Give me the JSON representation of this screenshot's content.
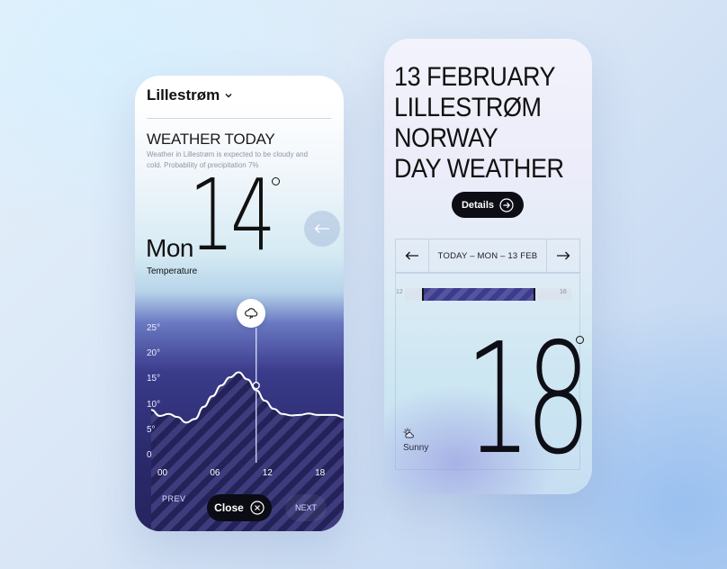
{
  "left_phone": {
    "city": "Lillestrøm",
    "title": "WEATHER TODAY",
    "description": "Weather in Lillestrøm is expected to be cloudy and cold. Probability of precipitation 7%",
    "temperature": "14",
    "day": "Mon",
    "day_sub": "Temperature",
    "prev_label": "PREV",
    "close_label": "Close",
    "next_label": "NEXT"
  },
  "right_phone": {
    "header_lines": [
      "13 FEBRUARY",
      "LILLESTRØM",
      "NORWAY",
      "DAY WEATHER"
    ],
    "details_label": "Details",
    "nav_label": "TODAY – MON – 13 FEB",
    "range_low": "12",
    "range_high": "16",
    "temperature": "18",
    "condition": "Sunny"
  },
  "icons": [
    "chevron-down-icon",
    "cloud-rain-icon",
    "close-circle-icon",
    "arrow-left-icon",
    "arrow-right-icon",
    "arrow-right-circle-icon",
    "partly-sunny-icon"
  ],
  "colors": {
    "accent_dark": "#2a2a6c",
    "button": "#0b0b13"
  },
  "chart_data": {
    "type": "line",
    "x": [
      0,
      1,
      2,
      3,
      4,
      5,
      6,
      7,
      8,
      9,
      10,
      11,
      12,
      13,
      14,
      15,
      16,
      17,
      18,
      19,
      20,
      21,
      22
    ],
    "values": [
      9,
      7.8,
      8.2,
      7.6,
      6.5,
      7.2,
      9.6,
      11.7,
      13.8,
      15.4,
      16.4,
      15,
      12.9,
      10.8,
      9.2,
      8.2,
      7.9,
      8,
      8.3,
      8,
      8,
      8,
      7.5
    ],
    "x_ticks": [
      "00",
      "06",
      "12",
      "18"
    ],
    "x_tick_positions": [
      0,
      6,
      12,
      18
    ],
    "y_ticks": [
      "25°",
      "20°",
      "15°",
      "10°",
      "5°",
      "0"
    ],
    "y_tick_values": [
      25,
      20,
      15,
      10,
      5,
      0
    ],
    "ylim": [
      0,
      25
    ],
    "xlim": [
      0,
      22
    ],
    "highlight_x": 12,
    "highlight_value": 13.8
  }
}
